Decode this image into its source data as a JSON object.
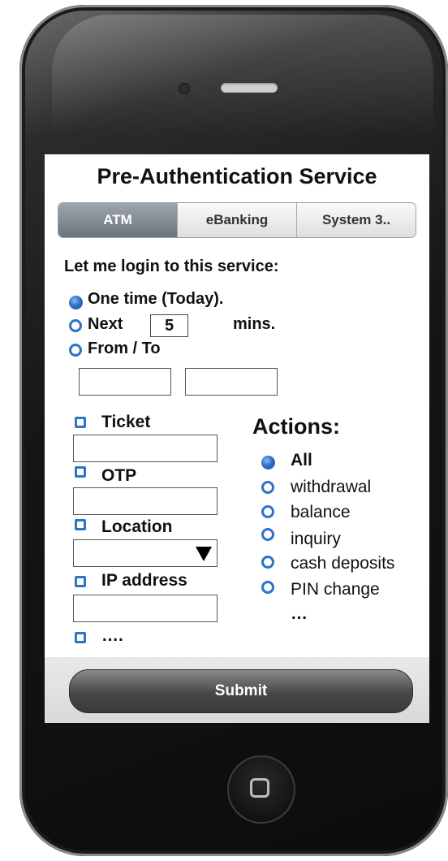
{
  "screen": {
    "title": "Pre-Authentication Service",
    "tabs": [
      {
        "label": "ATM",
        "active": true
      },
      {
        "label": "eBanking",
        "active": false
      },
      {
        "label": "System 3..",
        "active": false
      }
    ],
    "login_prompt": "Let me login to this service:",
    "time_options": [
      {
        "label": "One time (Today).",
        "selected": true
      },
      {
        "label": "Next",
        "selected": false
      },
      {
        "label": "From / To",
        "selected": false
      }
    ],
    "next_value": "5",
    "next_unit": "mins.",
    "from_value": "",
    "to_value": "",
    "factors": [
      {
        "label": "Ticket",
        "value": ""
      },
      {
        "label": "OTP",
        "value": ""
      },
      {
        "label": "Location",
        "value": ""
      },
      {
        "label": "IP address",
        "value": ""
      },
      {
        "label": "…."
      }
    ],
    "actions_title": "Actions:",
    "actions": [
      {
        "label": "All",
        "selected": true
      },
      {
        "label": "withdrawal",
        "selected": false
      },
      {
        "label": "balance",
        "selected": false
      },
      {
        "label": "inquiry",
        "selected": false
      },
      {
        "label": "cash deposits",
        "selected": false
      },
      {
        "label": "PIN change",
        "selected": false
      },
      {
        "label": "…"
      }
    ],
    "submit_label": "Submit"
  },
  "colors": {
    "accent": "#2f73c8",
    "active_tab": "#7f878f",
    "button": "#474747"
  },
  "icons": {
    "radio_selected": "radio-filled-icon",
    "radio_unselected": "radio-empty-icon",
    "checkbox": "checkbox-icon",
    "dropdown": "triangle-down-icon"
  }
}
